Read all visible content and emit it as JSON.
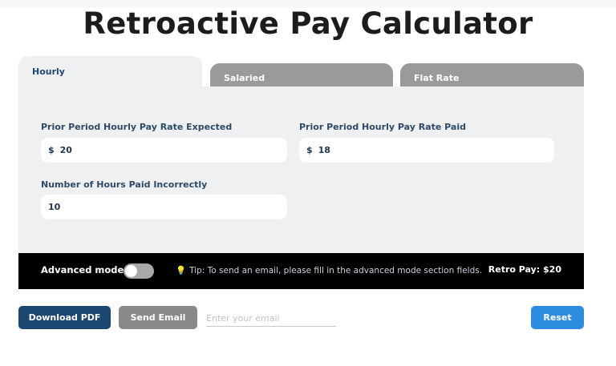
{
  "page": {
    "title": "Retroactive Pay Calculator"
  },
  "tabs": [
    {
      "label": "Hourly",
      "active": true
    },
    {
      "label": "Salaried",
      "active": false
    },
    {
      "label": "Flat Rate",
      "active": false
    }
  ],
  "form": {
    "expected_rate": {
      "label": "Prior Period Hourly Pay Rate Expected",
      "currency": "$",
      "value": "20"
    },
    "paid_rate": {
      "label": "Prior Period Hourly Pay Rate Paid",
      "currency": "$",
      "value": "18"
    },
    "hours": {
      "label": "Number of Hours Paid Incorrectly",
      "value": "10"
    }
  },
  "bar": {
    "advanced_label": "Advanced mode",
    "advanced_on": false,
    "tip_icon": "lightbulb-icon",
    "tip": "Tip: To send an email, please fill in the advanced mode section fields.",
    "result": "Retro Pay: $20"
  },
  "actions": {
    "download_label": "Download PDF",
    "send_label": "Send Email",
    "email_placeholder": "Enter your email",
    "reset_label": "Reset"
  },
  "colors": {
    "primary": "#1c4770",
    "accent": "#2e8ce0",
    "panel": "#eef0f2",
    "inactive_tab": "#9a9a9a"
  }
}
